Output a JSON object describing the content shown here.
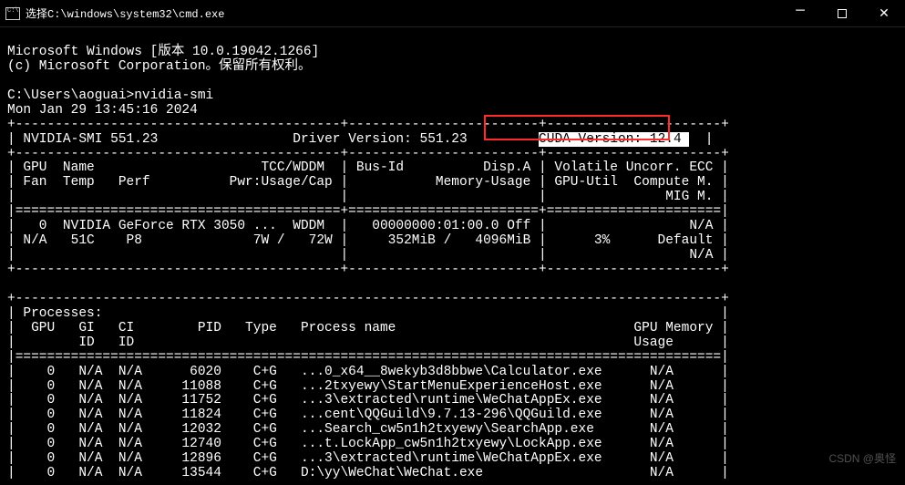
{
  "titlebar": {
    "title": "选择C:\\windows\\system32\\cmd.exe"
  },
  "header": {
    "line1": "Microsoft Windows [版本 10.0.19042.1266]",
    "line2": "(c) Microsoft Corporation。保留所有权利。"
  },
  "prompt": {
    "path": "C:\\Users\\aoguai>",
    "command": "nvidia-smi"
  },
  "smi": {
    "timestamp": "Mon Jan 29 13:45:16 2024       ",
    "version_label": "NVIDIA-SMI 551.23",
    "driver_label": "Driver Version: 551.23",
    "cuda_label": "CUDA Version: 12.4 ",
    "header_row1": "| GPU  Name                     TCC/WDDM  | Bus-Id          Disp.A | Volatile Uncorr. ECC |",
    "header_row2": "| Fan  Temp   Perf          Pwr:Usage/Cap |           Memory-Usage | GPU-Util  Compute M. |",
    "header_row3": "|                                         |                        |               MIG M. |",
    "gpu_row1": "|   0  NVIDIA GeForce RTX 3050 ...  WDDM  |   00000000:01:00.0 Off |                  N/A |",
    "gpu_row2": "| N/A   51C    P8              7W /   72W |     352MiB /   4096MiB |      3%      Default |",
    "gpu_row3": "|                                         |                        |                  N/A |"
  },
  "processes": {
    "title": "| Processes:                                                                              |",
    "header1": "|  GPU   GI   CI        PID   Type   Process name                              GPU Memory |",
    "header2": "|        ID   ID                                                               Usage      |",
    "rows": [
      "|    0   N/A  N/A      6020    C+G   ...0_x64__8wekyb3d8bbwe\\Calculator.exe      N/A      |",
      "|    0   N/A  N/A     11088    C+G   ...2txyewy\\StartMenuExperienceHost.exe      N/A      |",
      "|    0   N/A  N/A     11752    C+G   ...3\\extracted\\runtime\\WeChatAppEx.exe      N/A      |",
      "|    0   N/A  N/A     11824    C+G   ...cent\\QQGuild\\9.7.13-296\\QQGuild.exe      N/A      |",
      "|    0   N/A  N/A     12032    C+G   ...Search_cw5n1h2txyewy\\SearchApp.exe       N/A      |",
      "|    0   N/A  N/A     12740    C+G   ...t.LockApp_cw5n1h2txyewy\\LockApp.exe      N/A      |",
      "|    0   N/A  N/A     12896    C+G   ...3\\extracted\\runtime\\WeChatAppEx.exe      N/A      |",
      "|    0   N/A  N/A     13544    C+G   D:\\yy\\WeChat\\WeChat.exe                     N/A      |"
    ]
  },
  "watermark": "CSDN @奥怪",
  "border_top": "+-----------------------------------------+------------------------+----------------------+",
  "border_plain": "+-----------------------------------------------------------------------------------------+",
  "border_dbl": "|=========================================+========================+======================|",
  "border_dbl2": "|=========================================================================================|"
}
